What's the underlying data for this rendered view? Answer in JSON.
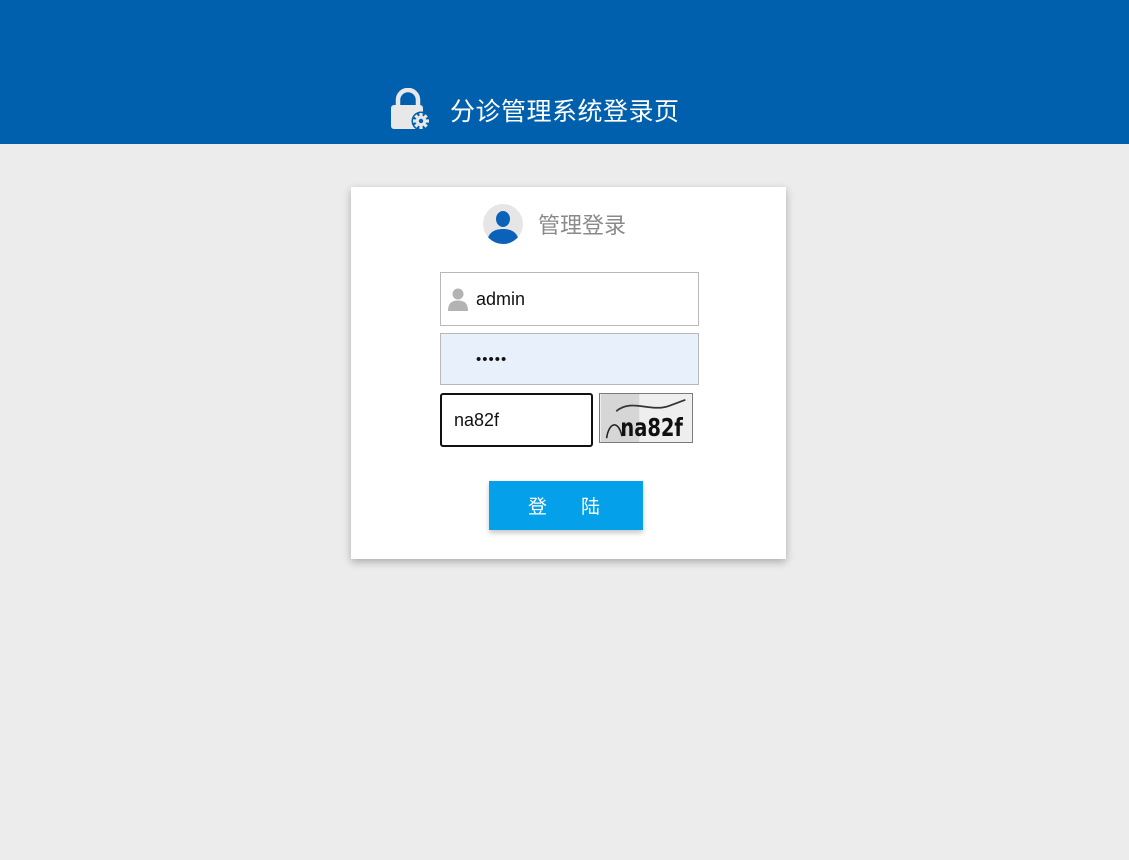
{
  "header": {
    "title": "分诊管理系统登录页",
    "icon": "lock-gear-icon",
    "background": "#0060ae"
  },
  "login_card": {
    "title": "管理登录",
    "avatar_icon": "user-avatar-icon",
    "username": {
      "value": "admin",
      "icon": "user-icon"
    },
    "password": {
      "value": "•••••"
    },
    "captcha": {
      "value": "na82f",
      "image_text": "na82f"
    },
    "submit_label": "登   陆",
    "button_color": "#04a0e9"
  }
}
